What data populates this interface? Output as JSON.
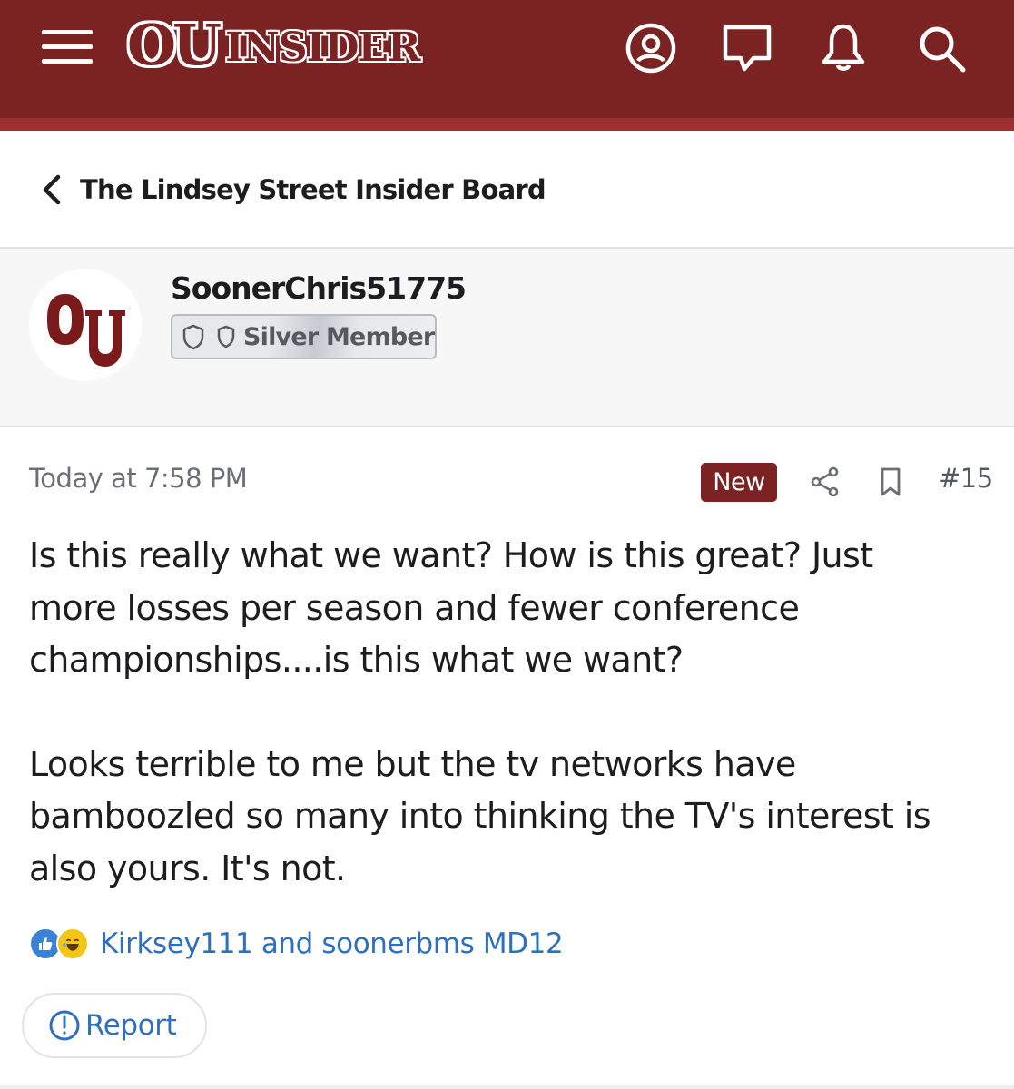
{
  "header": {
    "logo_ou": "OU",
    "logo_insider": "INSIDER",
    "icons": [
      "menu-icon",
      "account-icon",
      "chat-icon",
      "bell-icon",
      "search-icon"
    ],
    "brand_color": "#7b2222"
  },
  "breadcrumb": {
    "label": "The Lindsey Street Insider Board",
    "icon": "chevron-left-icon"
  },
  "author": {
    "username": "SoonerChris51775",
    "rank": "Silver Member",
    "avatar_icon": "ou-logo"
  },
  "post": {
    "timestamp": "Today at 7:58 PM",
    "new_label": "New",
    "post_number": "#15",
    "paragraphs": [
      "Is this really what we want? How is this great? Just\nmore losses per season and fewer conference\nchampionships....is this what we want?",
      "Looks terrible to me but the tv networks have\nbamboozled so many into thinking the TV's interest is\nalso yours. It's not."
    ],
    "reactions": {
      "icons": [
        "like-icon",
        "laugh-icon"
      ],
      "text": "Kirksey111 and soonerbms MD12"
    },
    "report_label": "Report"
  }
}
